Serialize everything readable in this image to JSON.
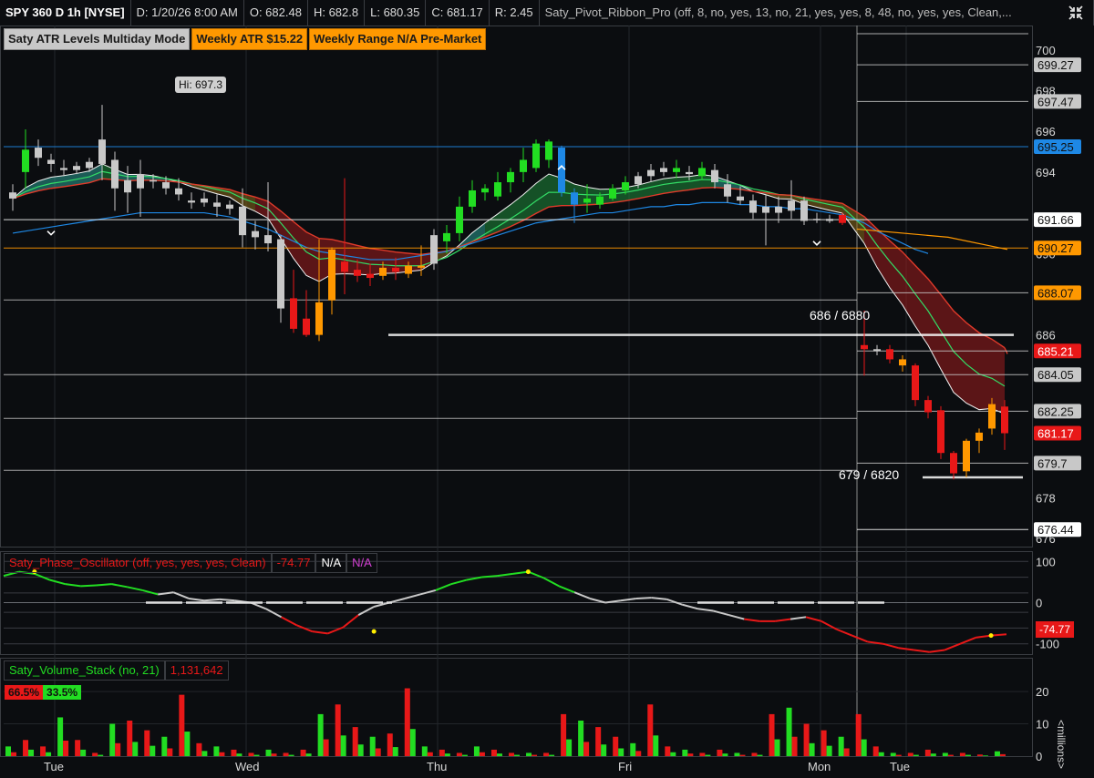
{
  "header": {
    "symbol": "SPY 360 D 1h [NYSE]",
    "date": "D: 1/20/26 8:00 AM",
    "open": "O: 682.48",
    "high": "H: 682.8",
    "low": "L: 680.35",
    "close": "C: 681.17",
    "range": "R: 2.45",
    "study": "Saty_Pivot_Ribbon_Pro (off, 8, no, yes, 13, no, 21, yes, yes, 8, 48, no, yes, yes, Clean,..."
  },
  "badges": {
    "mode": "Saty ATR Levels Multiday Mode",
    "weekly_atr": "Weekly ATR $15.22",
    "weekly_range": "Weekly Range N/A Pre-Market"
  },
  "annotations": {
    "hi_label": "Hi: 697.3",
    "level_686": "686 / 6880",
    "level_679": "679 / 6820"
  },
  "oscillator": {
    "title": "Saty_Phase_Oscillator (off, yes, yes, yes, Clean)",
    "value": "-74.77",
    "na1": "N/A",
    "na2": "N/A",
    "current_label": "-74.77"
  },
  "volume": {
    "title": "Saty_Volume_Stack (no, 21)",
    "value": "1,131,642",
    "red_pct": "66.5%",
    "green_pct": "33.5%",
    "unit_label": "<millions>"
  },
  "price_labels": [
    {
      "value": "699.27",
      "price": 699.27,
      "bg": "#c8c8c8",
      "fg": "#111111"
    },
    {
      "value": "697.47",
      "price": 697.47,
      "bg": "#c8c8c8",
      "fg": "#111111"
    },
    {
      "value": "695.25",
      "price": 695.25,
      "bg": "#1e88e5",
      "fg": "#111111"
    },
    {
      "value": "691.66",
      "price": 691.66,
      "bg": "#ffffff",
      "fg": "#111111"
    },
    {
      "value": "690.27",
      "price": 690.27,
      "bg": "#ff9800",
      "fg": "#111111"
    },
    {
      "value": "688.07",
      "price": 688.07,
      "bg": "#ff9800",
      "fg": "#111111"
    },
    {
      "value": "685.21",
      "price": 685.21,
      "bg": "#e81818",
      "fg": "#ffffff"
    },
    {
      "value": "684.05",
      "price": 684.05,
      "bg": "#c8c8c8",
      "fg": "#111111"
    },
    {
      "value": "682.25",
      "price": 682.25,
      "bg": "#c8c8c8",
      "fg": "#111111"
    },
    {
      "value": "681.17",
      "price": 681.17,
      "bg": "#e81818",
      "fg": "#ffffff"
    },
    {
      "value": "679.7",
      "price": 679.7,
      "bg": "#c8c8c8",
      "fg": "#111111"
    },
    {
      "value": "676.44",
      "price": 676.44,
      "bg": "#ffffff",
      "fg": "#111111"
    }
  ],
  "colors": {
    "background": "#0b0d10",
    "grid": "#23262b",
    "up": "#22dd22",
    "down": "#e81818",
    "neutral": "#c8c8c8",
    "orange": "#ff9800",
    "blue": "#1e88e5",
    "white": "#ffffff"
  },
  "chart_data": [
    {
      "type": "candlestick",
      "title": "SPY 360 D 1h [NYSE]",
      "y_ticks": [
        676,
        678,
        680,
        682,
        684,
        686,
        688,
        690,
        692,
        694,
        696,
        698,
        700
      ],
      "y_tick_labels": [
        "676",
        "678",
        "",
        "",
        "",
        "686",
        "",
        "690",
        "",
        "694",
        "696",
        "698",
        "700"
      ],
      "ylim": [
        675.6,
        701.2
      ],
      "x_day_labels": [
        "Tue",
        "Wed",
        "Thu",
        "Fri",
        "Mon",
        "Tue"
      ],
      "x_day_label_index": [
        3,
        18,
        33,
        48,
        63,
        69
      ],
      "session_breaks": [
        66,
        70
      ],
      "candles": [
        {
          "o": 693.0,
          "h": 693.4,
          "l": 692.1,
          "c": 692.7,
          "col": "neutral"
        },
        {
          "o": 694.0,
          "h": 696.1,
          "l": 693.2,
          "c": 695.1,
          "col": "up"
        },
        {
          "o": 695.2,
          "h": 695.6,
          "l": 694.3,
          "c": 694.7,
          "col": "neutral"
        },
        {
          "o": 694.6,
          "h": 694.9,
          "l": 694.0,
          "c": 694.4,
          "col": "neutral"
        },
        {
          "o": 694.2,
          "h": 694.6,
          "l": 693.8,
          "c": 694.1,
          "col": "neutral"
        },
        {
          "o": 694.1,
          "h": 694.5,
          "l": 693.9,
          "c": 694.3,
          "col": "neutral"
        },
        {
          "o": 694.2,
          "h": 694.7,
          "l": 694.0,
          "c": 694.5,
          "col": "neutral"
        },
        {
          "o": 694.4,
          "h": 697.3,
          "l": 693.6,
          "c": 695.6,
          "col": "neutral"
        },
        {
          "o": 694.6,
          "h": 695.0,
          "l": 692.1,
          "c": 693.2,
          "col": "neutral"
        },
        {
          "o": 693.6,
          "h": 694.3,
          "l": 692.0,
          "c": 693.0,
          "col": "neutral"
        },
        {
          "o": 693.2,
          "h": 694.6,
          "l": 691.8,
          "c": 693.9,
          "col": "neutral"
        },
        {
          "o": 693.6,
          "h": 693.9,
          "l": 693.2,
          "c": 693.6,
          "col": "neutral"
        },
        {
          "o": 693.5,
          "h": 693.8,
          "l": 692.9,
          "c": 693.2,
          "col": "neutral"
        },
        {
          "o": 693.2,
          "h": 693.7,
          "l": 692.6,
          "c": 692.9,
          "col": "neutral"
        },
        {
          "o": 692.6,
          "h": 693.0,
          "l": 692.2,
          "c": 692.5,
          "col": "neutral"
        },
        {
          "o": 692.7,
          "h": 693.0,
          "l": 692.3,
          "c": 692.5,
          "col": "neutral"
        },
        {
          "o": 692.5,
          "h": 692.9,
          "l": 691.8,
          "c": 692.3,
          "col": "neutral"
        },
        {
          "o": 692.4,
          "h": 692.6,
          "l": 691.9,
          "c": 692.2,
          "col": "neutral"
        },
        {
          "o": 692.3,
          "h": 693.2,
          "l": 690.3,
          "c": 690.9,
          "col": "neutral"
        },
        {
          "o": 690.8,
          "h": 691.6,
          "l": 690.2,
          "c": 691.1,
          "col": "neutral"
        },
        {
          "o": 690.9,
          "h": 693.5,
          "l": 690.1,
          "c": 690.5,
          "col": "neutral"
        },
        {
          "o": 690.7,
          "h": 690.9,
          "l": 686.6,
          "c": 687.3,
          "col": "neutral"
        },
        {
          "o": 687.8,
          "h": 689.2,
          "l": 686.1,
          "c": 686.3,
          "col": "down"
        },
        {
          "o": 686.8,
          "h": 688.2,
          "l": 685.9,
          "c": 686.0,
          "col": "down"
        },
        {
          "o": 686.0,
          "h": 690.7,
          "l": 685.7,
          "c": 687.6,
          "col": "orange"
        },
        {
          "o": 687.7,
          "h": 690.3,
          "l": 687.0,
          "c": 690.2,
          "col": "orange"
        },
        {
          "o": 689.6,
          "h": 693.7,
          "l": 688.0,
          "c": 689.1,
          "col": "down"
        },
        {
          "o": 689.2,
          "h": 689.7,
          "l": 688.6,
          "c": 688.9,
          "col": "down"
        },
        {
          "o": 689.0,
          "h": 689.5,
          "l": 688.4,
          "c": 688.8,
          "col": "down"
        },
        {
          "o": 688.9,
          "h": 689.6,
          "l": 688.7,
          "c": 689.3,
          "col": "orange"
        },
        {
          "o": 689.3,
          "h": 689.8,
          "l": 688.7,
          "c": 689.1,
          "col": "down"
        },
        {
          "o": 689.0,
          "h": 689.6,
          "l": 688.8,
          "c": 689.4,
          "col": "orange"
        },
        {
          "o": 689.3,
          "h": 690.4,
          "l": 688.9,
          "c": 689.4,
          "col": "orange"
        },
        {
          "o": 689.5,
          "h": 691.2,
          "l": 689.2,
          "c": 690.9,
          "col": "neutral"
        },
        {
          "o": 690.6,
          "h": 691.4,
          "l": 690.0,
          "c": 691.0,
          "col": "up"
        },
        {
          "o": 691.0,
          "h": 692.8,
          "l": 690.6,
          "c": 692.3,
          "col": "up"
        },
        {
          "o": 692.3,
          "h": 693.6,
          "l": 692.0,
          "c": 693.1,
          "col": "up"
        },
        {
          "o": 693.0,
          "h": 693.4,
          "l": 692.6,
          "c": 693.2,
          "col": "up"
        },
        {
          "o": 692.8,
          "h": 694.0,
          "l": 692.6,
          "c": 693.5,
          "col": "up"
        },
        {
          "o": 693.5,
          "h": 694.2,
          "l": 693.0,
          "c": 694.0,
          "col": "up"
        },
        {
          "o": 694.0,
          "h": 695.2,
          "l": 693.5,
          "c": 694.6,
          "col": "up"
        },
        {
          "o": 694.2,
          "h": 695.6,
          "l": 694.0,
          "c": 695.4,
          "col": "up"
        },
        {
          "o": 694.6,
          "h": 695.6,
          "l": 694.2,
          "c": 695.5,
          "col": "up"
        },
        {
          "o": 695.2,
          "h": 695.3,
          "l": 692.8,
          "c": 693.0,
          "col": "blue"
        },
        {
          "o": 693.0,
          "h": 693.2,
          "l": 691.5,
          "c": 692.4,
          "col": "blue"
        },
        {
          "o": 692.5,
          "h": 693.4,
          "l": 692.0,
          "c": 692.7,
          "col": "up"
        },
        {
          "o": 692.4,
          "h": 693.0,
          "l": 692.2,
          "c": 692.8,
          "col": "up"
        },
        {
          "o": 692.7,
          "h": 693.4,
          "l": 692.6,
          "c": 693.2,
          "col": "up"
        },
        {
          "o": 693.1,
          "h": 693.8,
          "l": 692.9,
          "c": 693.5,
          "col": "up"
        },
        {
          "o": 693.4,
          "h": 694.0,
          "l": 693.2,
          "c": 693.8,
          "col": "neutral"
        },
        {
          "o": 693.8,
          "h": 694.4,
          "l": 693.5,
          "c": 694.1,
          "col": "neutral"
        },
        {
          "o": 694.0,
          "h": 694.5,
          "l": 693.8,
          "c": 694.2,
          "col": "neutral"
        },
        {
          "o": 694.2,
          "h": 694.6,
          "l": 693.7,
          "c": 694.0,
          "col": "up"
        },
        {
          "o": 694.0,
          "h": 694.3,
          "l": 693.6,
          "c": 693.9,
          "col": "neutral"
        },
        {
          "o": 693.8,
          "h": 694.5,
          "l": 693.6,
          "c": 694.2,
          "col": "up"
        },
        {
          "o": 694.1,
          "h": 694.4,
          "l": 693.2,
          "c": 693.5,
          "col": "neutral"
        },
        {
          "o": 693.4,
          "h": 693.9,
          "l": 692.5,
          "c": 692.8,
          "col": "neutral"
        },
        {
          "o": 692.8,
          "h": 693.3,
          "l": 692.4,
          "c": 692.6,
          "col": "neutral"
        },
        {
          "o": 692.6,
          "h": 692.9,
          "l": 691.7,
          "c": 692.0,
          "col": "neutral"
        },
        {
          "o": 692.0,
          "h": 692.9,
          "l": 690.4,
          "c": 692.3,
          "col": "neutral"
        },
        {
          "o": 692.3,
          "h": 692.8,
          "l": 691.5,
          "c": 692.0,
          "col": "neutral"
        },
        {
          "o": 692.1,
          "h": 693.6,
          "l": 691.7,
          "c": 692.6,
          "col": "neutral"
        },
        {
          "o": 692.6,
          "h": 692.8,
          "l": 691.4,
          "c": 691.6,
          "col": "neutral"
        },
        {
          "o": 691.7,
          "h": 692.0,
          "l": 691.5,
          "c": 691.7,
          "col": "neutral"
        },
        {
          "o": 691.7,
          "h": 691.9,
          "l": 691.5,
          "c": 691.6,
          "col": "neutral"
        },
        {
          "o": 691.9,
          "h": 692.0,
          "l": 691.4,
          "c": 691.5,
          "col": "down"
        },
        {
          "o": 685.5,
          "h": 687.2,
          "l": 684.0,
          "c": 685.3,
          "col": "down"
        },
        {
          "o": 685.3,
          "h": 685.5,
          "l": 685.0,
          "c": 685.2,
          "col": "neutral"
        },
        {
          "o": 685.3,
          "h": 685.5,
          "l": 684.6,
          "c": 684.8,
          "col": "down"
        },
        {
          "o": 684.8,
          "h": 685.0,
          "l": 684.2,
          "c": 684.5,
          "col": "orange"
        },
        {
          "o": 684.5,
          "h": 684.6,
          "l": 682.5,
          "c": 682.8,
          "col": "down"
        },
        {
          "o": 682.8,
          "h": 683.0,
          "l": 681.9,
          "c": 682.2,
          "col": "down"
        },
        {
          "o": 682.3,
          "h": 682.5,
          "l": 679.9,
          "c": 680.2,
          "col": "down"
        },
        {
          "o": 680.2,
          "h": 680.3,
          "l": 678.9,
          "c": 679.2,
          "col": "down"
        },
        {
          "o": 679.3,
          "h": 680.9,
          "l": 679.0,
          "c": 680.8,
          "col": "orange"
        },
        {
          "o": 680.8,
          "h": 681.4,
          "l": 680.2,
          "c": 681.2,
          "col": "orange"
        },
        {
          "o": 681.4,
          "h": 682.9,
          "l": 681.1,
          "c": 682.6,
          "col": "orange"
        },
        {
          "o": 682.48,
          "h": 682.8,
          "l": 680.35,
          "c": 681.17,
          "col": "down"
        }
      ],
      "horizontal_levels": [
        {
          "price": 700.8,
          "color": "#c8c8c8"
        },
        {
          "price": 699.27,
          "color": "#c8c8c8"
        },
        {
          "price": 697.47,
          "color": "#c8c8c8"
        },
        {
          "price": 695.25,
          "color": "#1e88e5"
        },
        {
          "price": 691.66,
          "color": "#ffffff"
        },
        {
          "price": 690.27,
          "color": "#ff9800"
        },
        {
          "price": 688.07,
          "color": "#c8c8c8"
        },
        {
          "price": 686.0,
          "color": "#ffffff"
        },
        {
          "price": 685.21,
          "color": "#c8c8c8"
        },
        {
          "price": 684.05,
          "color": "#c8c8c8"
        },
        {
          "price": 682.25,
          "color": "#c8c8c8"
        },
        {
          "price": 679.7,
          "color": "#c8c8c8"
        },
        {
          "price": 679.0,
          "color": "#ffffff"
        },
        {
          "price": 676.44,
          "color": "#ffffff"
        }
      ],
      "ema_48": [
        691.0,
        691.1,
        691.2,
        691.3,
        691.4,
        691.5,
        691.6,
        691.7,
        691.8,
        691.9,
        692.0,
        692.0,
        692.0,
        692.0,
        692.0,
        692.0,
        691.9,
        691.8,
        691.6,
        691.4,
        691.2,
        690.9,
        690.6,
        690.3,
        690.1,
        690.0,
        689.9,
        689.8,
        689.7,
        689.7,
        689.7,
        689.8,
        689.9,
        690.0,
        690.1,
        690.3,
        690.5,
        690.7,
        690.9,
        691.1,
        691.3,
        691.5,
        691.6,
        691.7,
        691.8,
        691.9,
        692.0,
        692.0,
        692.1,
        692.2,
        692.3,
        692.3,
        692.4,
        692.4,
        692.5,
        692.5,
        692.5,
        692.4,
        692.4,
        692.3,
        692.3,
        692.2,
        692.2,
        692.1,
        692.0,
        691.9,
        691.5,
        691.1,
        690.8,
        690.5,
        690.2,
        690.0
      ]
    },
    {
      "type": "line",
      "title": "Saty_Phase_Oscillator (off, yes, yes, yes, Clean)",
      "y_ticks": [
        100,
        0,
        -100
      ],
      "ylim": [
        -125,
        125
      ],
      "values": [
        65,
        75,
        70,
        55,
        45,
        40,
        42,
        45,
        38,
        30,
        20,
        25,
        10,
        5,
        8,
        5,
        0,
        -15,
        -35,
        -55,
        -70,
        -75,
        -60,
        -30,
        -10,
        0,
        10,
        20,
        30,
        45,
        55,
        62,
        65,
        70,
        75,
        60,
        40,
        25,
        10,
        0,
        5,
        10,
        12,
        8,
        -5,
        -15,
        -20,
        -30,
        -40,
        -45,
        -45,
        -40,
        -35,
        -45,
        -65,
        -80,
        -95,
        -100,
        -110,
        -115,
        -120,
        -115,
        -100,
        -85,
        -80,
        -77
      ],
      "series_colors_note": "green above zero trend, red below, grey neutral"
    },
    {
      "type": "bar",
      "title": "Saty_Volume_Stack (no, 21)",
      "y_ticks": [
        0,
        10,
        20
      ],
      "ylim": [
        0,
        22
      ],
      "values": [
        3,
        5,
        3,
        12,
        5,
        1,
        10,
        11,
        8,
        6,
        19,
        4,
        3,
        2,
        1,
        2,
        1,
        2,
        13,
        16,
        9,
        6,
        7,
        21,
        3,
        2,
        1,
        3,
        2,
        1,
        1,
        1,
        13,
        11,
        9,
        6,
        4,
        16,
        3,
        2,
        1,
        2,
        1,
        1,
        13,
        15,
        10,
        8,
        6,
        13,
        3,
        1,
        1,
        2,
        1,
        1,
        0.5,
        1.5
      ]
    }
  ]
}
